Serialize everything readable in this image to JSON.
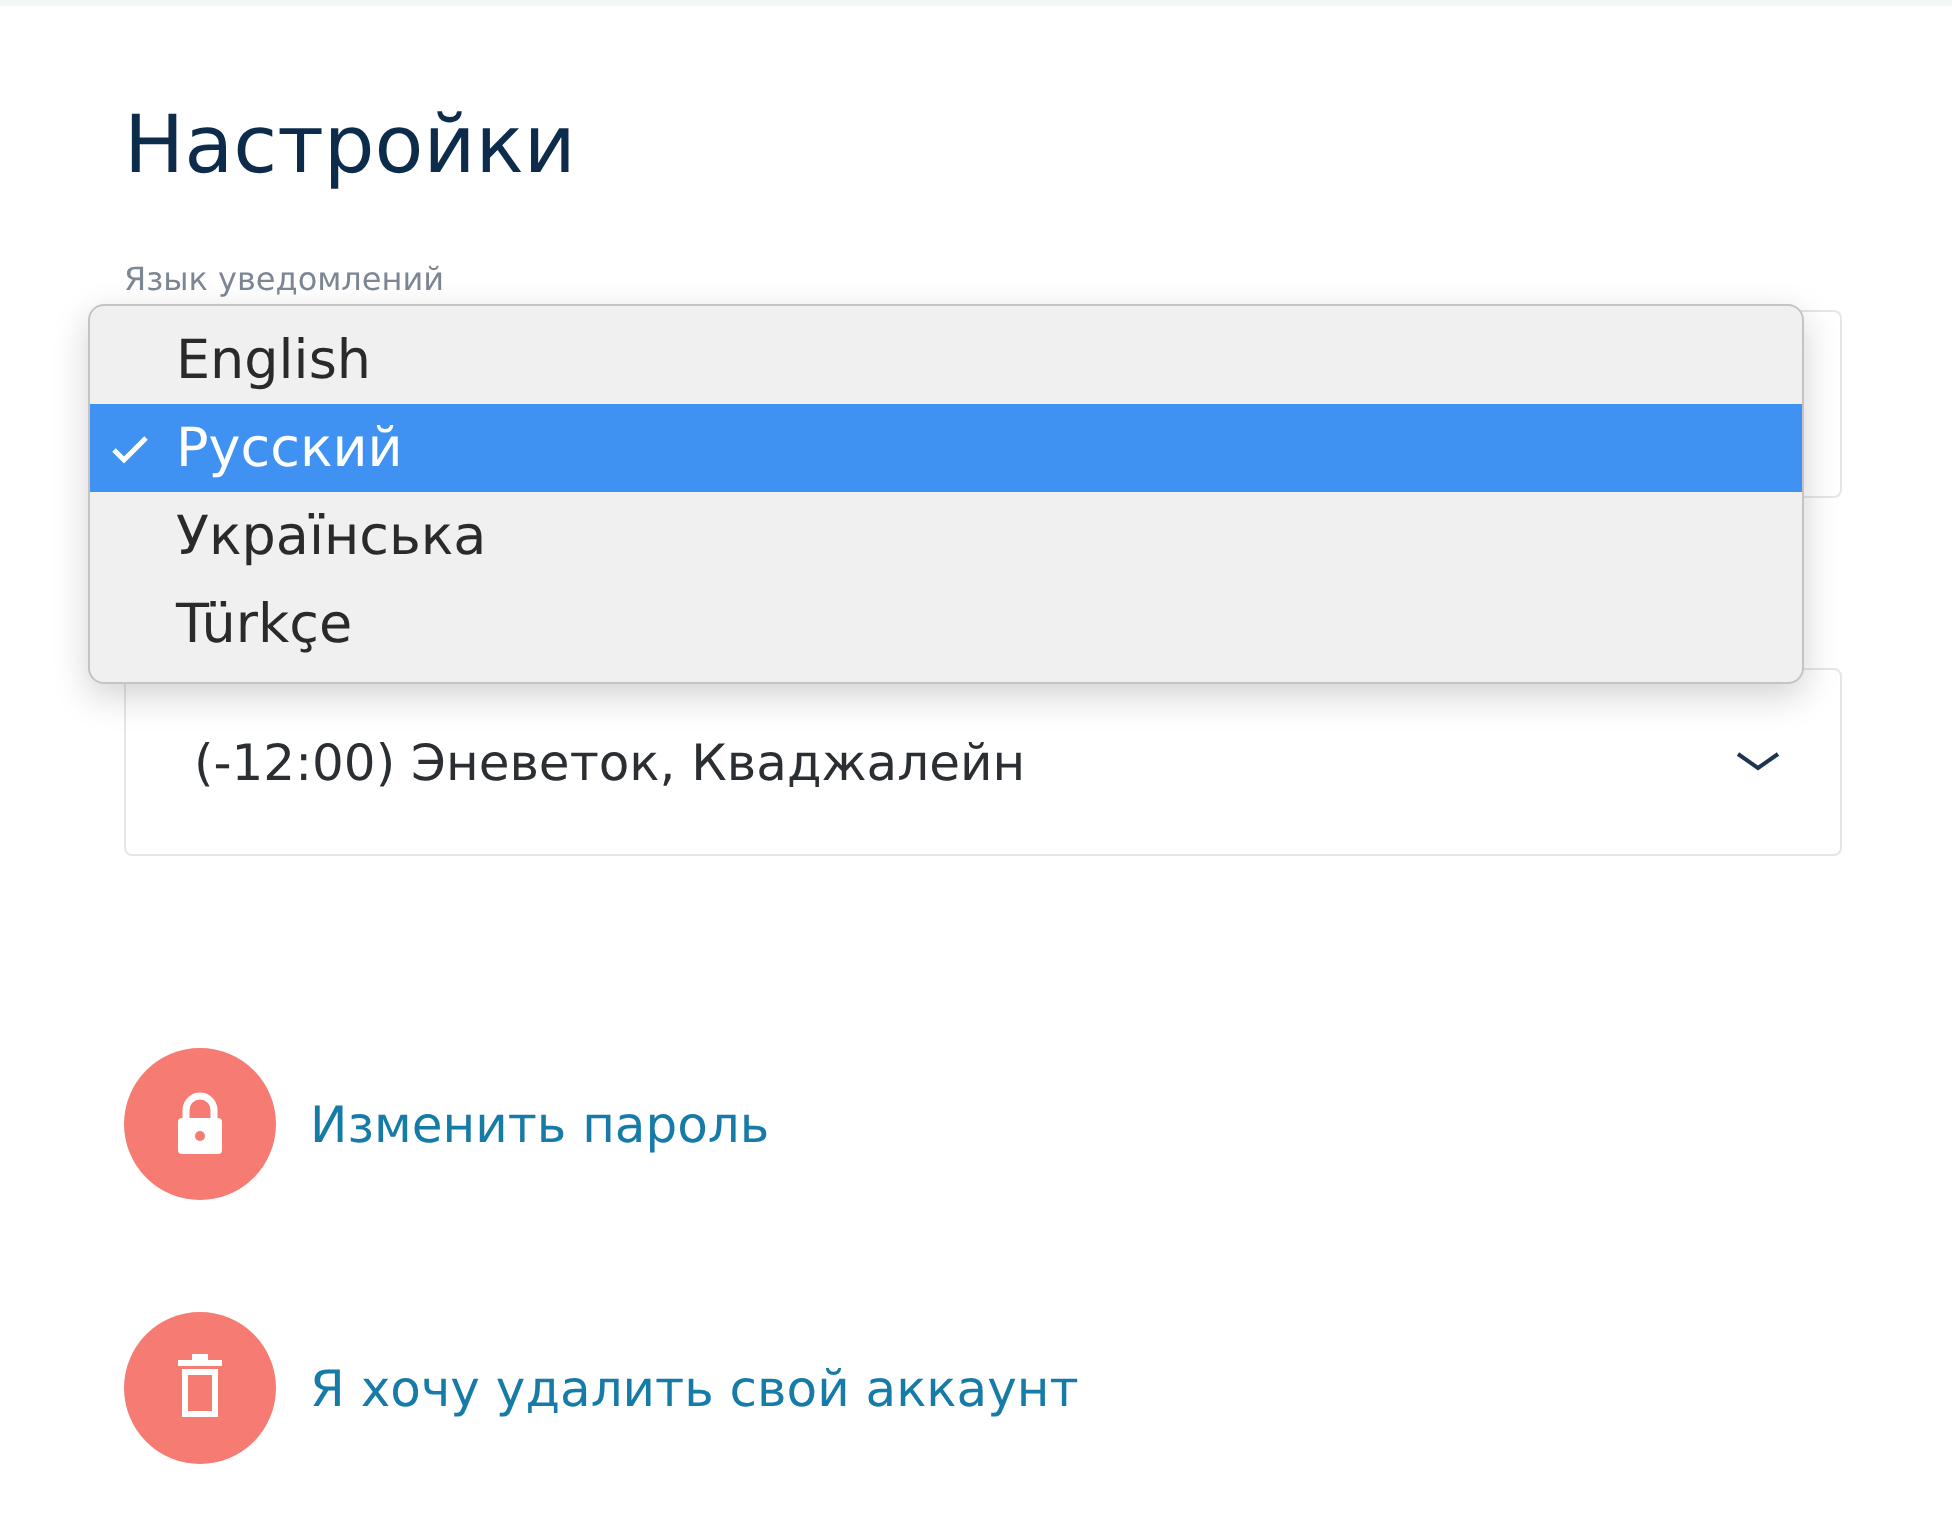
{
  "title": "Настройки",
  "notification_language": {
    "label": "Язык уведомлений",
    "options": [
      {
        "label": "English",
        "selected": false
      },
      {
        "label": "Русский",
        "selected": true
      },
      {
        "label": "Українська",
        "selected": false
      },
      {
        "label": "Türkçe",
        "selected": false
      }
    ]
  },
  "timezone": {
    "value": "(-12:00) Эневеток, Кваджалейн"
  },
  "actions": [
    {
      "label": "Изменить пароль",
      "kind": "lock"
    },
    {
      "label": "Я хочу удалить свой аккаунт",
      "kind": "trash"
    }
  ]
}
